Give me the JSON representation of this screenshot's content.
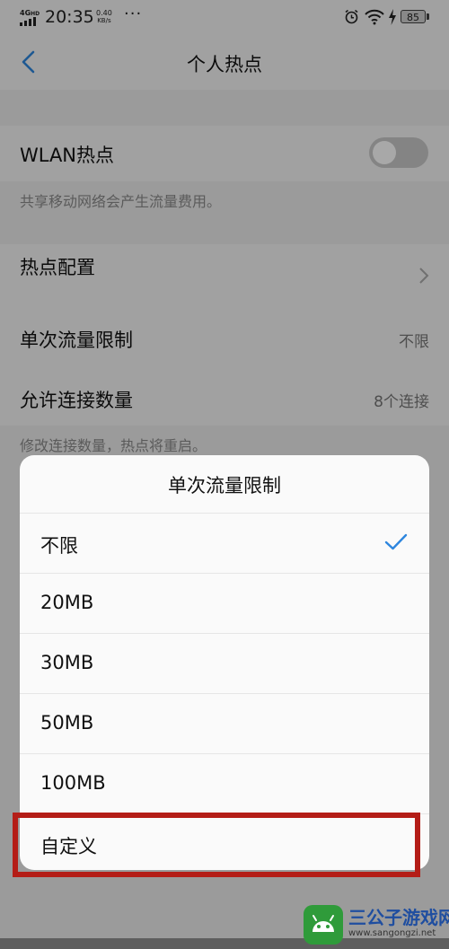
{
  "status_bar": {
    "network": "4G",
    "network_sup": "HD",
    "time": "20:35",
    "speed_value": "0.40",
    "speed_unit": "KB/s",
    "more": "···",
    "battery": "85",
    "icons": [
      "signal-icon",
      "alarm-icon",
      "wifi-icon",
      "charging-icon",
      "battery-icon"
    ]
  },
  "header": {
    "title": "个人热点",
    "back_icon": "chevron-left-icon"
  },
  "settings": {
    "wlan_hotspot": {
      "label": "WLAN热点",
      "enabled": false
    },
    "wlan_note": "共享移动网络会产生流量费用。",
    "hotspot_config": {
      "label": "热点配置"
    },
    "data_limit": {
      "label": "单次流量限制",
      "value": "不限"
    },
    "connections": {
      "label": "允许连接数量",
      "value": "8个连接"
    },
    "connections_note": "修改连接数量，热点将重启。"
  },
  "sheet": {
    "title": "单次流量限制",
    "options": [
      {
        "label": "不限",
        "selected": true
      },
      {
        "label": "20MB",
        "selected": false
      },
      {
        "label": "30MB",
        "selected": false
      },
      {
        "label": "50MB",
        "selected": false
      },
      {
        "label": "100MB",
        "selected": false
      },
      {
        "label": "自定义",
        "selected": false,
        "highlighted": true
      }
    ]
  },
  "watermark": {
    "name": "三公子游戏网",
    "url": "www.sangongzi.net"
  },
  "colors": {
    "accent": "#2e86de",
    "highlight_border": "#b41d17",
    "watermark_green": "#2f9b3a",
    "watermark_text": "#1f4ea0"
  }
}
